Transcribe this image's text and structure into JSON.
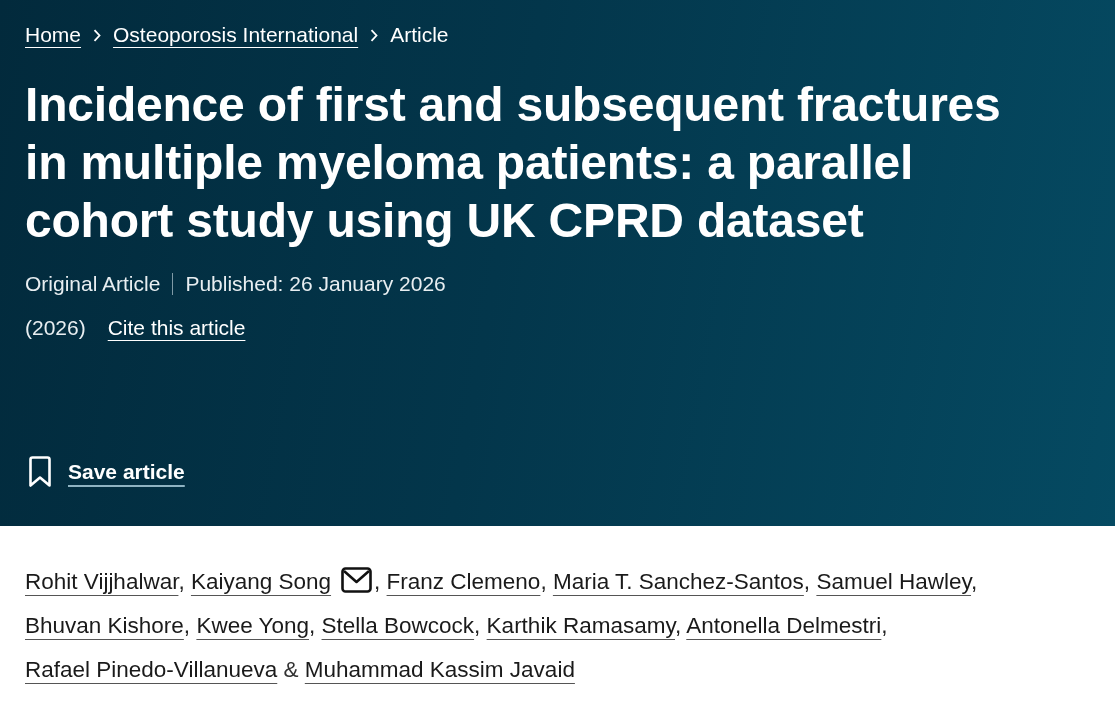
{
  "breadcrumb": [
    {
      "label": "Home",
      "current": false
    },
    {
      "label": "Osteoporosis International",
      "current": false
    },
    {
      "label": "Article",
      "current": true
    }
  ],
  "article": {
    "title": "Incidence of first and subsequent fractures in multiple myeloma patients: a parallel cohort study using UK CPRD dataset",
    "article_type": "Original Article",
    "published": "Published: 26 January 2026",
    "year": "(2026)",
    "cite_link": "Cite this article",
    "save_button": "Save article"
  },
  "authors": [
    {
      "name": "Rohit Vijjhalwar",
      "corresponding": false,
      "trailing": ","
    },
    {
      "name": "Kaiyang Song",
      "corresponding": true,
      "trailing": ","
    },
    {
      "name": "Franz Clemeno",
      "corresponding": false,
      "trailing": ","
    },
    {
      "name": "Maria T. Sanchez-Santos",
      "corresponding": false,
      "trailing": ","
    },
    {
      "name": "Samuel Hawley",
      "corresponding": false,
      "trailing": ","
    },
    {
      "name": "Bhuvan Kishore",
      "corresponding": false,
      "trailing": ","
    },
    {
      "name": "Kwee Yong",
      "corresponding": false,
      "trailing": ","
    },
    {
      "name": "Stella Bowcock",
      "corresponding": false,
      "trailing": ","
    },
    {
      "name": "Karthik Ramasamy",
      "corresponding": false,
      "trailing": ","
    },
    {
      "name": "Antonella Delmestri",
      "corresponding": false,
      "trailing": ","
    },
    {
      "name": "Rafael Pinedo-Villanueva",
      "corresponding": false
    },
    {
      "name": "Muhammad Kassim Javaid",
      "corresponding": false,
      "lead": "&"
    }
  ]
}
